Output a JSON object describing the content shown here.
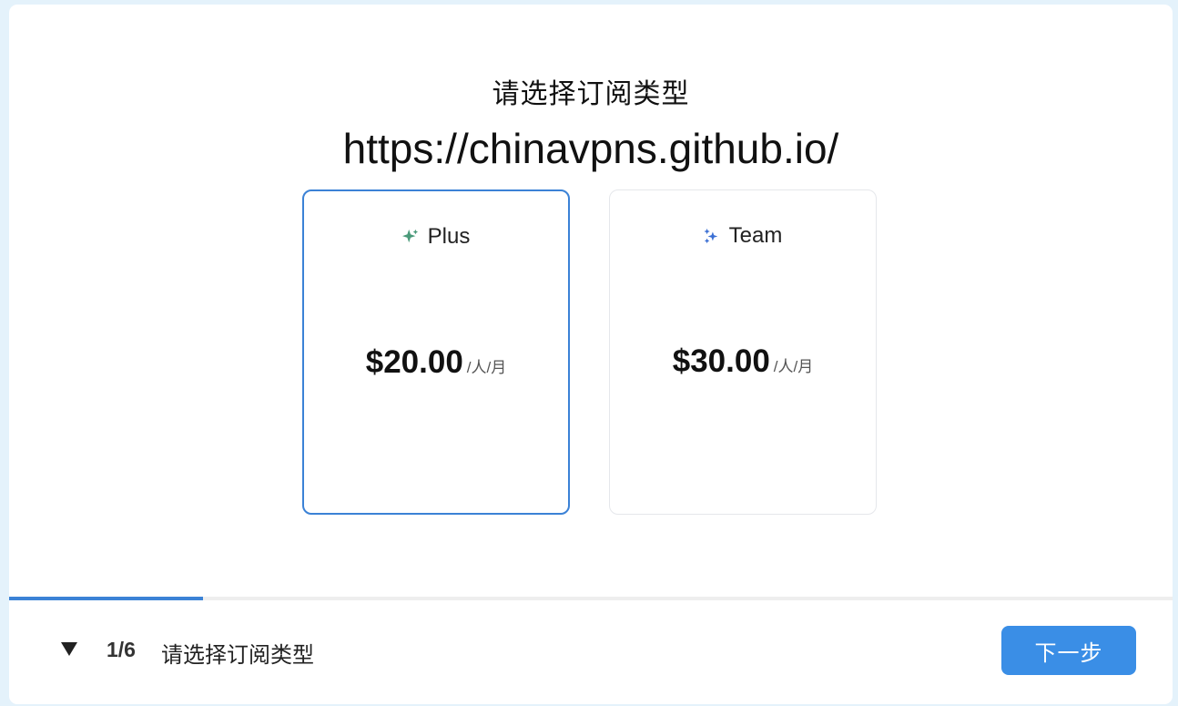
{
  "heading": "请选择订阅类型",
  "url": "https://chinavpns.github.io/",
  "plans": [
    {
      "name": "Plus",
      "price": "$20.00",
      "unit": "/人/月",
      "selected": true,
      "icon": "sparkle-icon-green"
    },
    {
      "name": "Team",
      "price": "$30.00",
      "unit": "/人/月",
      "selected": false,
      "icon": "sparkle-icon-blue"
    }
  ],
  "progress": {
    "value": 0.1667
  },
  "footer": {
    "step": "1/6",
    "step_label": "请选择订阅类型",
    "next_label": "下一步"
  },
  "colors": {
    "accent": "#3b82d6",
    "button": "#3a8ee6",
    "plus_icon": "#4a9a7a",
    "team_icon": "#3b6fd4"
  }
}
